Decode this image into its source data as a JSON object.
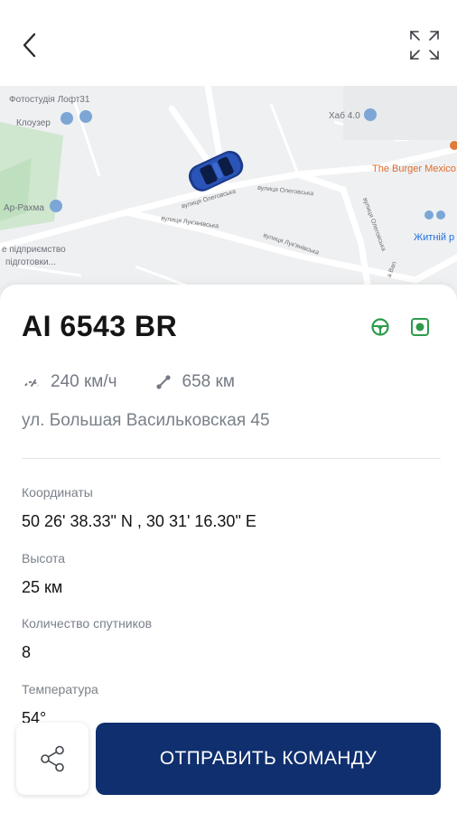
{
  "header": {
    "back_icon": "chevron-left-icon",
    "expand_icon": "fullscreen-icon"
  },
  "map": {
    "labels": {
      "photo_studio": "Фотостудія Лофт31",
      "klouzer": "Клоузер",
      "hub": "Хаб 4.0",
      "burger": "The Burger Mexico",
      "ar_rahma": "Ар-Рахма",
      "enterprise": "е підприємство",
      "training": "підготовки...",
      "residential": "Житній р",
      "street_1": "вулиця Олеговська",
      "street_2": "вулиця Олеговська",
      "street_3": "вулиця Лук'янівська",
      "street_4": "вулиця Лук'янівська",
      "street_5": "вулиця Олеговська",
      "street_6": "а Ваn"
    },
    "car_color": "#2a54b8"
  },
  "vehicle": {
    "plate": "AI 6543 BR",
    "steer_color": "#2e9b4a",
    "status_color": "#2e9b4a",
    "speed": "240 км/ч",
    "mileage": "658 км",
    "address": "ул. Большая Васильковская 45"
  },
  "details": [
    {
      "label": "Координаты",
      "value": "50 26' 38.33\" N , 30 31' 16.30\" E"
    },
    {
      "label": "Высота",
      "value": "25 км"
    },
    {
      "label": "Количество спутников",
      "value": "8"
    },
    {
      "label": "Температура",
      "value": "54°"
    }
  ],
  "footer": {
    "command_label": "ОТПРАВИТЬ КОМАНДУ",
    "accent_color": "#0f2f6e"
  }
}
